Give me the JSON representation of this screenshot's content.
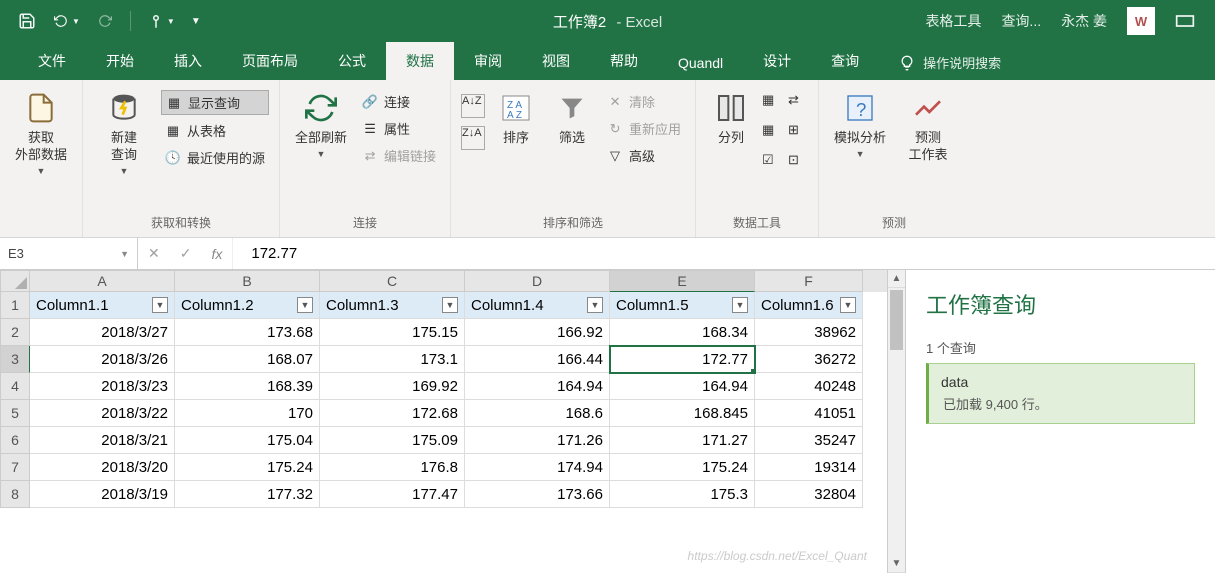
{
  "title": {
    "doc": "工作簿2",
    "sep": "-",
    "app": "Excel"
  },
  "title_right": {
    "table_tools": "表格工具",
    "query_ctx": "查询...",
    "user": "永杰 姜"
  },
  "tabs": {
    "file": "文件",
    "home": "开始",
    "insert": "插入",
    "page_layout": "页面布局",
    "formulas": "公式",
    "data": "数据",
    "review": "审阅",
    "view": "视图",
    "help": "帮助",
    "quandl": "Quandl",
    "design": "设计",
    "query": "查询",
    "tell_me": "操作说明搜索"
  },
  "ribbon": {
    "get_transform": {
      "label": "获取和转换",
      "get_external": "获取\n外部数据",
      "new_query": "新建\n查询",
      "show_queries": "显示查询",
      "from_table": "从表格",
      "recent": "最近使用的源"
    },
    "connections": {
      "label": "连接",
      "refresh_all": "全部刷新",
      "connections": "连接",
      "properties": "属性",
      "edit_links": "编辑链接"
    },
    "sort_filter": {
      "label": "排序和筛选",
      "sort": "排序",
      "filter": "筛选",
      "clear": "清除",
      "reapply": "重新应用",
      "advanced": "高级"
    },
    "data_tools": {
      "label": "数据工具",
      "text_to_cols": "分列"
    },
    "forecast": {
      "label": "预测",
      "whatif": "模拟分析",
      "forecast_sheet": "预测\n工作表"
    }
  },
  "formula_bar": {
    "name_box": "E3",
    "value": "172.77"
  },
  "grid": {
    "col_letters": [
      "A",
      "B",
      "C",
      "D",
      "E",
      "F"
    ],
    "headers": [
      "Column1.1",
      "Column1.2",
      "Column1.3",
      "Column1.4",
      "Column1.5",
      "Column1.6"
    ],
    "rows": [
      [
        "2018/3/27",
        "173.68",
        "175.15",
        "166.92",
        "168.34",
        "38962"
      ],
      [
        "2018/3/26",
        "168.07",
        "173.1",
        "166.44",
        "172.77",
        "36272"
      ],
      [
        "2018/3/23",
        "168.39",
        "169.92",
        "164.94",
        "164.94",
        "40248"
      ],
      [
        "2018/3/22",
        "170",
        "172.68",
        "168.6",
        "168.845",
        "41051"
      ],
      [
        "2018/3/21",
        "175.04",
        "175.09",
        "171.26",
        "171.27",
        "35247"
      ],
      [
        "2018/3/20",
        "175.24",
        "176.8",
        "174.94",
        "175.24",
        "19314"
      ],
      [
        "2018/3/19",
        "177.32",
        "177.47",
        "173.66",
        "175.3",
        "32804"
      ]
    ],
    "selected": {
      "row": 3,
      "col": 5
    }
  },
  "side_panel": {
    "title": "工作簿查询",
    "sub": "1 个查询",
    "query_name": "data",
    "query_status": "已加载 9,400 行。"
  },
  "watermark": "https://blog.csdn.net/Excel_Quant"
}
